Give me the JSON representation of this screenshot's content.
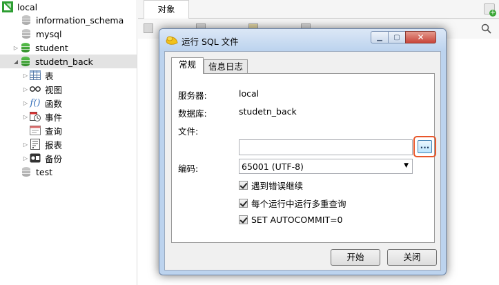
{
  "tree": {
    "connection": "local",
    "databases": [
      "information_schema",
      "mysql",
      "student",
      "studetn_back",
      "test"
    ],
    "expanded_db": "studetn_back",
    "children": [
      {
        "label": "表",
        "icon": "table-icon"
      },
      {
        "label": "视图",
        "icon": "view-icon"
      },
      {
        "label": "函数",
        "icon": "function-icon"
      },
      {
        "label": "事件",
        "icon": "event-icon"
      },
      {
        "label": "查询",
        "icon": "query-icon"
      },
      {
        "label": "报表",
        "icon": "report-icon"
      },
      {
        "label": "备份",
        "icon": "backup-icon"
      }
    ]
  },
  "main": {
    "tab": "对象"
  },
  "dialog": {
    "title": "运行 SQL 文件",
    "tabs": [
      "常规",
      "信息日志"
    ],
    "active_tab": "常规",
    "fields": {
      "server_label": "服务器:",
      "server_value": "local",
      "database_label": "数据库:",
      "database_value": "studetn_back",
      "file_label": "文件:",
      "file_value": "",
      "browse_label": "...",
      "encoding_label": "编码:",
      "encoding_value": "65001 (UTF-8)"
    },
    "options": [
      {
        "label": "遇到错误继续",
        "checked": true
      },
      {
        "label": "每个运行中运行多重查询",
        "checked": true
      },
      {
        "label": "SET AUTOCOMMIT=0",
        "checked": true
      }
    ],
    "buttons": {
      "start": "开始",
      "close": "关闭"
    }
  },
  "colors": {
    "db_active": "#2f8d28",
    "db_inactive": "#a9a9a9",
    "highlight": "#e8562a",
    "dialog_frame": "#bcd3ee"
  }
}
